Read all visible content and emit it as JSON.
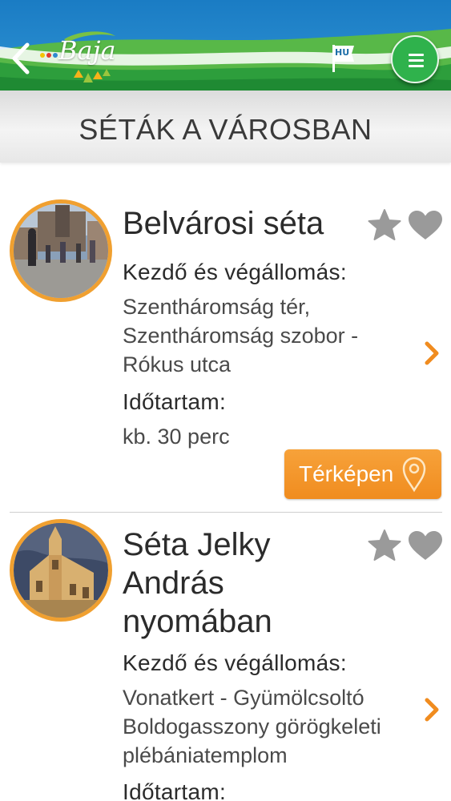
{
  "header": {
    "logo_text": "Baja",
    "language": "HU",
    "accent_green": "#2fb24c",
    "accent_blue": "#1b7fc6"
  },
  "page": {
    "title": "SÉTÁK A VÁROSBAN"
  },
  "walks": [
    {
      "title": "Belvárosi séta",
      "start_end_label": "Kezdő és végállomás:",
      "start_end_value": "Szentháromság tér, Szentháromság szobor - Rókus utca",
      "duration_label": "Időtartam:",
      "duration_value": "kb. 30 perc",
      "map_button_label": "Térképen"
    },
    {
      "title": "Séta Jelky András nyomában",
      "start_end_label": "Kezdő és végállomás:",
      "start_end_value": "Vonatkert - Gyümölcsoltó Boldogasszony görögkeleti plébániatemplom",
      "duration_label": "Időtartam:"
    }
  ],
  "colors": {
    "orange": "#f0a030",
    "icon_grey": "#9a9a9a"
  }
}
